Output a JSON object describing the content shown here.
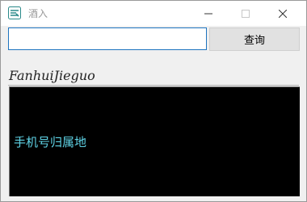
{
  "window": {
    "title": "酒入",
    "controls": {
      "minimize_icon": "minimize-icon",
      "maximize_icon": "maximize-icon",
      "close_icon": "close-icon"
    }
  },
  "search": {
    "value": "",
    "placeholder": "",
    "button_label": "查询"
  },
  "result": {
    "label": "FanhuiJieguo",
    "output_text": "手机号归属地"
  },
  "colors": {
    "accent": "#1e74bf",
    "output_bg": "#000000",
    "output_text": "#5fd3e6"
  }
}
